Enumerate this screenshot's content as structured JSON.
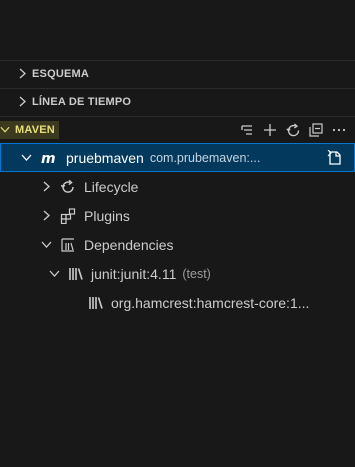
{
  "sections": {
    "esquema": {
      "label": "ESQUEMA"
    },
    "linea_tiempo": {
      "label": "LÍNEA DE TIEMPO"
    },
    "maven": {
      "label": "MAVEN",
      "actions": [
        "filter-icon",
        "add-icon",
        "refresh-icon",
        "collapse-all-icon",
        "more-icon"
      ]
    }
  },
  "tree": {
    "project": {
      "name": "pruebmaven",
      "description": "com.prubemaven:..."
    },
    "lifecycle": {
      "label": "Lifecycle"
    },
    "plugins": {
      "label": "Plugins"
    },
    "dependencies": {
      "label": "Dependencies"
    },
    "junit": {
      "label": "junit:junit:4.11",
      "scope": "(test)"
    },
    "hamcrest": {
      "label": "org.hamcrest:hamcrest-core:1..."
    }
  },
  "colors": {
    "background": "#181818",
    "selection": "#04395e",
    "selection_border": "#0078d4",
    "maven_header": "#e8e07a",
    "text": "#cccccc"
  }
}
